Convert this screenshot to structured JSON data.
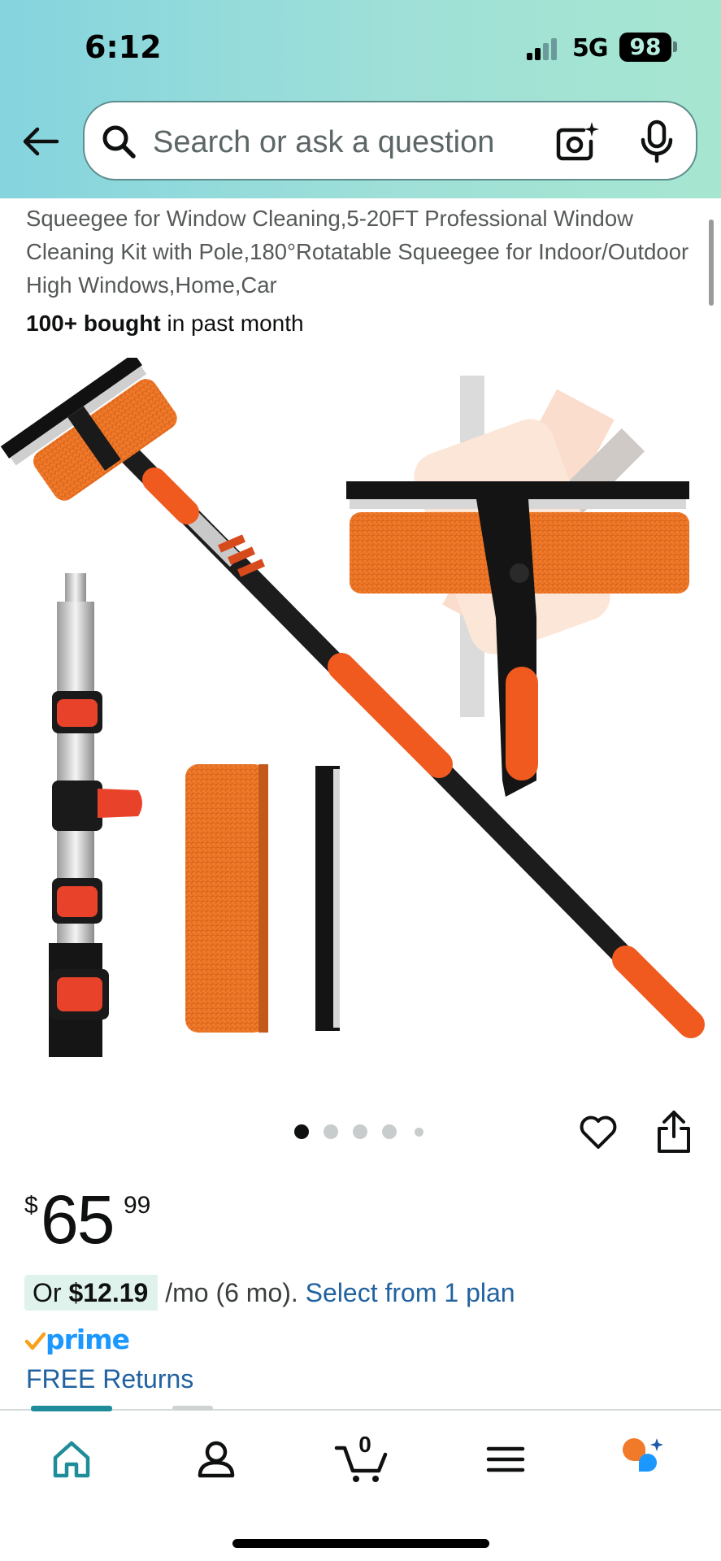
{
  "status_bar": {
    "time": "6:12",
    "network": "5GUC",
    "network_display": "5G",
    "battery": "98"
  },
  "search": {
    "placeholder": "Search or ask a question"
  },
  "product": {
    "title": "Squeegee for Window Cleaning,5-20FT Professional Window Cleaning Kit with Pole,180°Rotatable Squeegee for Indoor/Outdoor High Windows,Home,Car",
    "bought_bold": "100+ bought",
    "bought_rest": " in past month",
    "image_alt": "Telescopic window squeegee with orange scrubber pad, extension pole, replacement pad and blade",
    "image_carousel": {
      "total": 5,
      "active_index": 0
    },
    "price": {
      "symbol": "$",
      "whole": "65",
      "fraction": "99"
    },
    "installment": {
      "prefix": "Or ",
      "amount": "$12.19",
      "term": " /mo (6 mo). ",
      "link": "Select from 1 plan"
    },
    "prime_label": "prime",
    "returns_label": "FREE Returns"
  },
  "bottom_nav": {
    "items": [
      {
        "name": "home",
        "icon": "home-icon",
        "active": true
      },
      {
        "name": "account",
        "icon": "person-icon",
        "active": false
      },
      {
        "name": "cart",
        "icon": "cart-icon",
        "active": false
      },
      {
        "name": "menu",
        "icon": "hamburger-icon",
        "active": false
      },
      {
        "name": "rufus",
        "icon": "rufus-icon",
        "active": false
      }
    ],
    "cart_count": "0"
  },
  "colors": {
    "header_gradient_start": "#85d4de",
    "header_gradient_end": "#a6e6d0",
    "link": "#2162a1",
    "prime_blue": "#1a98ff",
    "prime_check": "#f7a21b",
    "active_nav": "#1e8c99",
    "product_orange": "#f07a2a"
  }
}
